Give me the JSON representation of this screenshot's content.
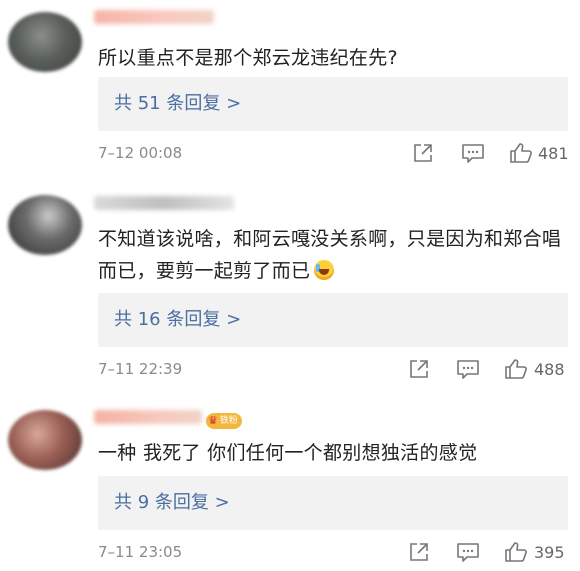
{
  "comments": [
    {
      "text": "所以重点不是那个郑云龙违纪在先?",
      "emoji": false,
      "reply_label": "共 51 条回复 >",
      "time": "7–12 00:08",
      "likes": "481",
      "badge": ""
    },
    {
      "text": "不知道该说啥，和阿云嘎没关系啊，只是因为和郑合唱而已，要剪一起剪了而已",
      "emoji": true,
      "emoji_name": "crying-laughing-face",
      "reply_label": "共 16 条回复 >",
      "time": "7–11 22:39",
      "likes": "488",
      "badge": ""
    },
    {
      "text": "一种 我死了 你们任何一个都别想独活的感觉",
      "emoji": false,
      "reply_label": "共 9 条回复 >",
      "time": "7–11 23:05",
      "likes": "395",
      "badge": "铁粉"
    }
  ],
  "icons": {
    "share": "share-icon",
    "comment": "comment-icon",
    "like": "thumb-up-icon"
  },
  "colors": {
    "reply_link": "#4a6fa0",
    "reply_bg": "#f2f2f2",
    "meta_text": "#8a8a8a",
    "badge_bg": "#f3b63f"
  }
}
